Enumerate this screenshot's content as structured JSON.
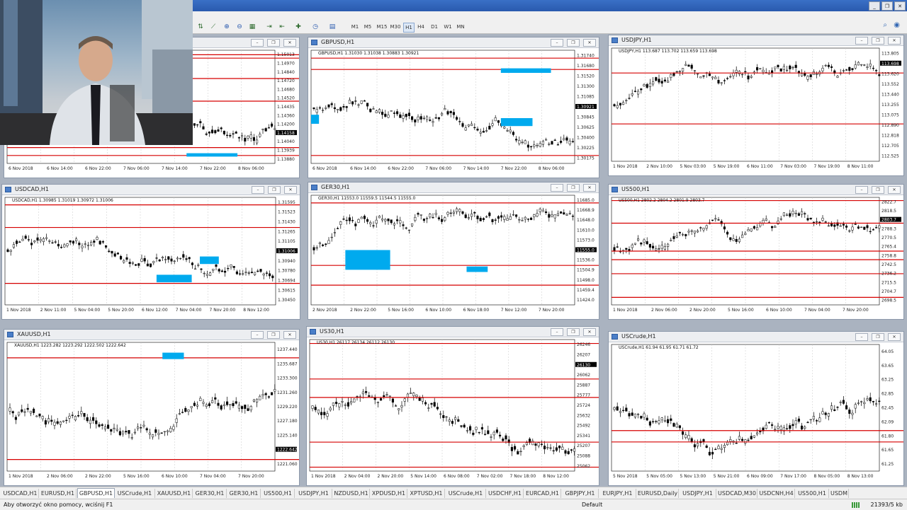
{
  "app": {
    "accent": "#2a5aae"
  },
  "toolbar": {
    "timeframes": [
      "M1",
      "M5",
      "M15",
      "M30",
      "H1",
      "H4",
      "D1",
      "W1",
      "MN"
    ],
    "active_timeframe": "H1"
  },
  "colors": {
    "level_line": "#d60000",
    "zone": "#00aaee",
    "candle": "#000000",
    "grid": "#c8c8c8"
  },
  "charts": [
    {
      "title": "",
      "head": "",
      "price_labels": [
        "1.15013",
        "1.14970",
        "1.14840",
        "1.14720",
        "1.14680",
        "1.14520",
        "1.14435",
        "1.14360",
        "1.14200",
        "1.14158",
        "1.14040",
        "1.13939",
        "1.13880"
      ],
      "time_labels": [
        "6 Nov 2018",
        "6 Nov 14:00",
        "6 Nov 22:00",
        "7 Nov 06:00",
        "7 Nov 14:00",
        "7 Nov 22:00",
        "8 Nov 06:00"
      ],
      "current": "1.14158"
    },
    {
      "title": "GBPUSD,H1",
      "head": "GBPUSD,H1  1.31030 1.31038 1.30883 1.30921",
      "price_labels": [
        "1.31740",
        "1.31680",
        "1.31520",
        "1.31300",
        "1.31085",
        "1.30921",
        "1.30845",
        "1.30625",
        "1.30400",
        "1.30225",
        "1.30175"
      ],
      "time_labels": [
        "6 Nov 2018",
        "6 Nov 14:00",
        "6 Nov 22:00",
        "7 Nov 06:00",
        "7 Nov 14:00",
        "7 Nov 22:00",
        "8 Nov 06:00"
      ],
      "current": "1.30921"
    },
    {
      "title": "USDJPY,H1",
      "head": "USDJPY,H1  113.687 113.702 113.659 113.698",
      "price_labels": [
        "113.805",
        "113.698",
        "113.620",
        "113.552",
        "113.440",
        "113.255",
        "113.075",
        "112.890",
        "112.818",
        "112.705",
        "112.525"
      ],
      "time_labels": [
        "1 Nov 2018",
        "2 Nov 10:00",
        "5 Nov 03:00",
        "5 Nov 19:00",
        "6 Nov 11:00",
        "7 Nov 03:00",
        "7 Nov 19:00",
        "8 Nov 11:00"
      ],
      "current": "113.698"
    },
    {
      "title": "USDCAD,H1",
      "head": "USDCAD,H1  1.30985 1.31019 1.30972 1.31006",
      "price_labels": [
        "1.31595",
        "1.31523",
        "1.31430",
        "1.31265",
        "1.31105",
        "1.31006",
        "1.30940",
        "1.30780",
        "1.30694",
        "1.30615",
        "1.30450"
      ],
      "time_labels": [
        "1 Nov 2018",
        "2 Nov 11:00",
        "5 Nov 04:00",
        "5 Nov 20:00",
        "6 Nov 12:00",
        "7 Nov 04:00",
        "7 Nov 20:00",
        "8 Nov 12:00"
      ],
      "current": "1.31006"
    },
    {
      "title": "GER30,H1",
      "head": "GER30,H1  11553.0 11559.5 11544.5 11555.0",
      "price_labels": [
        "11685.0",
        "11668.9",
        "11648.0",
        "11610.0",
        "11573.0",
        "11555.0",
        "11536.0",
        "11504.9",
        "11498.0",
        "11459.4",
        "11424.0"
      ],
      "time_labels": [
        "2 Nov 2018",
        "2 Nov 22:00",
        "5 Nov 16:00",
        "6 Nov 10:00",
        "6 Nov 18:00",
        "7 Nov 12:00",
        "7 Nov 20:00"
      ],
      "current": "11555.0"
    },
    {
      "title": "US500,H1",
      "head": "US500,H1  2802.2 2804.2 2801.9 2803.7",
      "price_labels": [
        "2822.7",
        "2818.5",
        "2803.7",
        "2788.3",
        "2770.5",
        "2765.4",
        "2758.8",
        "2742.5",
        "2736.2",
        "2715.5",
        "2704.7",
        "2698.5"
      ],
      "time_labels": [
        "1 Nov 2018",
        "2 Nov 06:00",
        "2 Nov 20:00",
        "5 Nov 16:00",
        "6 Nov 10:00",
        "7 Nov 04:00",
        "7 Nov 20:00"
      ],
      "current": "2803.7"
    },
    {
      "title": "XAUUSD,H1",
      "head": "XAUUSD,H1  1223.282 1223.292 1222.502 1222.642",
      "price_labels": [
        "1237.440",
        "1235.687",
        "1233.300",
        "1231.260",
        "1229.220",
        "1227.180",
        "1225.140",
        "1222.642",
        "1221.060"
      ],
      "time_labels": [
        "1 Nov 2018",
        "2 Nov 06:00",
        "2 Nov 22:00",
        "5 Nov 16:00",
        "6 Nov 10:00",
        "7 Nov 04:00",
        "7 Nov 20:00"
      ],
      "current": "1222.642"
    },
    {
      "title": "US30,H1",
      "head": "US30,H1  26117 26134 26112 26130",
      "price_labels": [
        "26246",
        "26207",
        "26130",
        "26062",
        "25887",
        "25777",
        "25724",
        "25632",
        "25492",
        "25341",
        "25207",
        "25088",
        "25062"
      ],
      "time_labels": [
        "1 Nov 2018",
        "2 Nov 04:00",
        "2 Nov 20:00",
        "5 Nov 14:00",
        "6 Nov 08:00",
        "7 Nov 02:00",
        "7 Nov 18:00",
        "8 Nov 12:00"
      ],
      "current": "26130"
    },
    {
      "title": "USCrude,H1",
      "head": "USCrude,H1  61.94 61.95 61.71 61.72",
      "price_labels": [
        "64.05",
        "63.65",
        "63.25",
        "62.85",
        "62.45",
        "62.09",
        "61.80",
        "61.65",
        "61.25"
      ],
      "time_labels": [
        "5 Nov 2018",
        "5 Nov 05:00",
        "5 Nov 13:00",
        "5 Nov 21:00",
        "6 Nov 09:00",
        "7 Nov 17:00",
        "8 Nov 05:00",
        "8 Nov 13:00"
      ],
      "current": "61.72"
    }
  ],
  "tabs": [
    "USDCAD,H1",
    "EURUSD,H1",
    "GBPUSD,H1",
    "USCrude,H1",
    "XAUUSD,H1",
    "GER30,H1",
    "GER30,H1",
    "US500,H1",
    "USDJPY,H1",
    "NZDUSD,H1",
    "XPDUSD,H1",
    "XPTUSD,H1",
    "USCrude,H1",
    "USDCHF,H1",
    "EURCAD,H1",
    "GBPJPY,H1",
    "EURJPY,H1",
    "EURUSD,Daily",
    "USDJPY,H1",
    "USDCAD,M30",
    "USDCNH,H4",
    "US500,H1",
    "USDM"
  ],
  "active_tab": 2,
  "status": {
    "help": "Aby otworzyć okno pomocy, wciśnij F1",
    "profile": "Default",
    "traffic": "21393/5 kb"
  }
}
